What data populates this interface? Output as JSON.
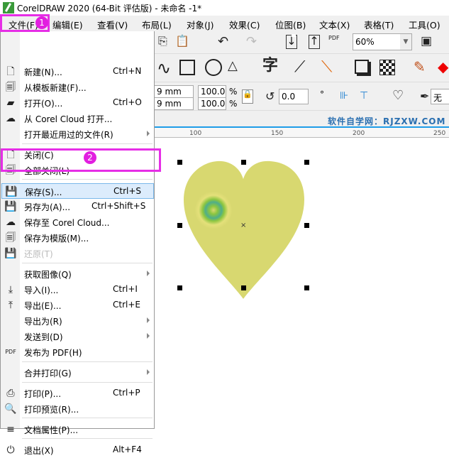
{
  "window": {
    "title": "CorelDRAW 2020 (64-Bit 评估版) - 未命名 -1*"
  },
  "menubar": [
    "文件(F)",
    "编辑(E)",
    "查看(V)",
    "布局(L)",
    "对象(J)",
    "效果(C)",
    "位图(B)",
    "文本(X)",
    "表格(T)",
    "工具(O)"
  ],
  "badges": [
    "1",
    "2"
  ],
  "toolbar": {
    "zoom": "60%",
    "pdf": "PDF",
    "w_val": "9 mm",
    "h_val": "9 mm",
    "sx": "100.0",
    "sy": "100.0",
    "pct": "%",
    "rotation": "0.0",
    "deg": "°",
    "outline": "无",
    "char": "字"
  },
  "watermark": "软件自学网：RJZXW.COM",
  "ruler": [
    "100",
    "150",
    "200",
    "250"
  ],
  "file_menu": [
    {
      "label": "新建(N)...",
      "shortcut": "Ctrl+N",
      "icon": "new-doc-icon"
    },
    {
      "label": "从模板新建(F)...",
      "icon": "new-from-template-icon"
    },
    {
      "label": "打开(O)...",
      "shortcut": "Ctrl+O",
      "icon": "folder-open-icon"
    },
    {
      "label": "从 Corel Cloud 打开...",
      "icon": "cloud-download-icon"
    },
    {
      "label": "打开最近用过的文件(R)",
      "submenu": true
    },
    {
      "label": "关闭(C)",
      "icon": "close-doc-icon"
    },
    {
      "label": "全部关闭(L)",
      "icon": "close-all-icon"
    },
    {
      "label": "保存(S)...",
      "shortcut": "Ctrl+S",
      "icon": "save-icon",
      "highlighted": true
    },
    {
      "label": "另存为(A)...",
      "shortcut": "Ctrl+Shift+S",
      "icon": "save-as-icon"
    },
    {
      "label": "保存至 Corel Cloud...",
      "icon": "cloud-upload-icon"
    },
    {
      "label": "保存为模版(M)...",
      "icon": "save-template-icon"
    },
    {
      "label": "还原(T)",
      "icon": "revert-icon",
      "disabled": true
    },
    {
      "label": "获取图像(Q)",
      "submenu": true
    },
    {
      "label": "导入(I)...",
      "shortcut": "Ctrl+I",
      "icon": "import-icon"
    },
    {
      "label": "导出(E)...",
      "shortcut": "Ctrl+E",
      "icon": "export-icon"
    },
    {
      "label": "导出为(R)",
      "submenu": true
    },
    {
      "label": "发送到(D)",
      "submenu": true
    },
    {
      "label": "发布为 PDF(H)",
      "icon": "pdf-icon"
    },
    {
      "label": "合并打印(G)",
      "submenu": true
    },
    {
      "label": "打印(P)...",
      "shortcut": "Ctrl+P",
      "icon": "print-icon"
    },
    {
      "label": "打印预览(R)...",
      "icon": "print-preview-icon"
    },
    {
      "label": "文档属性(P)...",
      "icon": "doc-properties-icon"
    },
    {
      "label": "退出(X)",
      "shortcut": "Alt+F4",
      "icon": "power-icon"
    }
  ]
}
